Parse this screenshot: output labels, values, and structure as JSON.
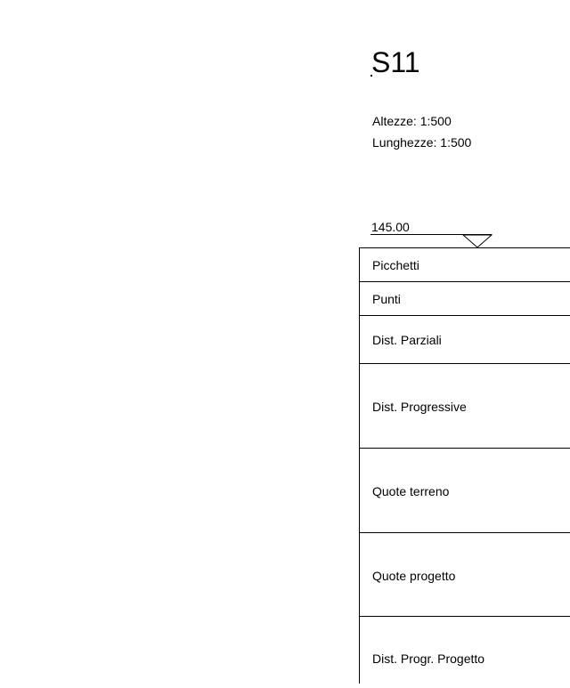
{
  "section": {
    "title": "S11"
  },
  "scales": {
    "heights": "Altezze:  1:500",
    "lengths": "Lunghezze: 1:500"
  },
  "datum": {
    "elevation": "145.00"
  },
  "table": {
    "rows": [
      {
        "label": "Picchetti"
      },
      {
        "label": "Punti"
      },
      {
        "label": "Dist. Parziali"
      },
      {
        "label": "Dist. Progressive"
      },
      {
        "label": "Quote terreno"
      },
      {
        "label": "Quote progetto"
      },
      {
        "label": "Dist. Progr. Progetto"
      }
    ]
  }
}
